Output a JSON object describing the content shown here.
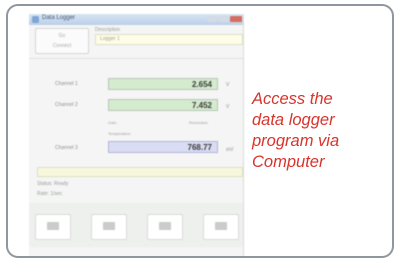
{
  "screenshot": {
    "title": "Data Logger",
    "header_label": "Description",
    "header_value": "Logger 1",
    "top_button": {
      "line1": "Go",
      "line2": "Connect"
    },
    "rows": [
      {
        "label": "Channel 1",
        "value": "2.654",
        "unit": "V"
      },
      {
        "label": "Channel 2",
        "value": "7.452",
        "unit": "V"
      },
      {
        "label": "Channel 3",
        "value": "768.77",
        "unit": "mV"
      }
    ],
    "mid_labels": {
      "left": "Gain",
      "right": "Resolution",
      "above_third": "Temperature"
    },
    "info_lines": [
      "Status: Ready",
      "Rate: 1/sec"
    ]
  },
  "caption": {
    "lines": [
      "Access the",
      "data logger",
      "program via",
      "Computer"
    ],
    "color": "#d8342c"
  }
}
